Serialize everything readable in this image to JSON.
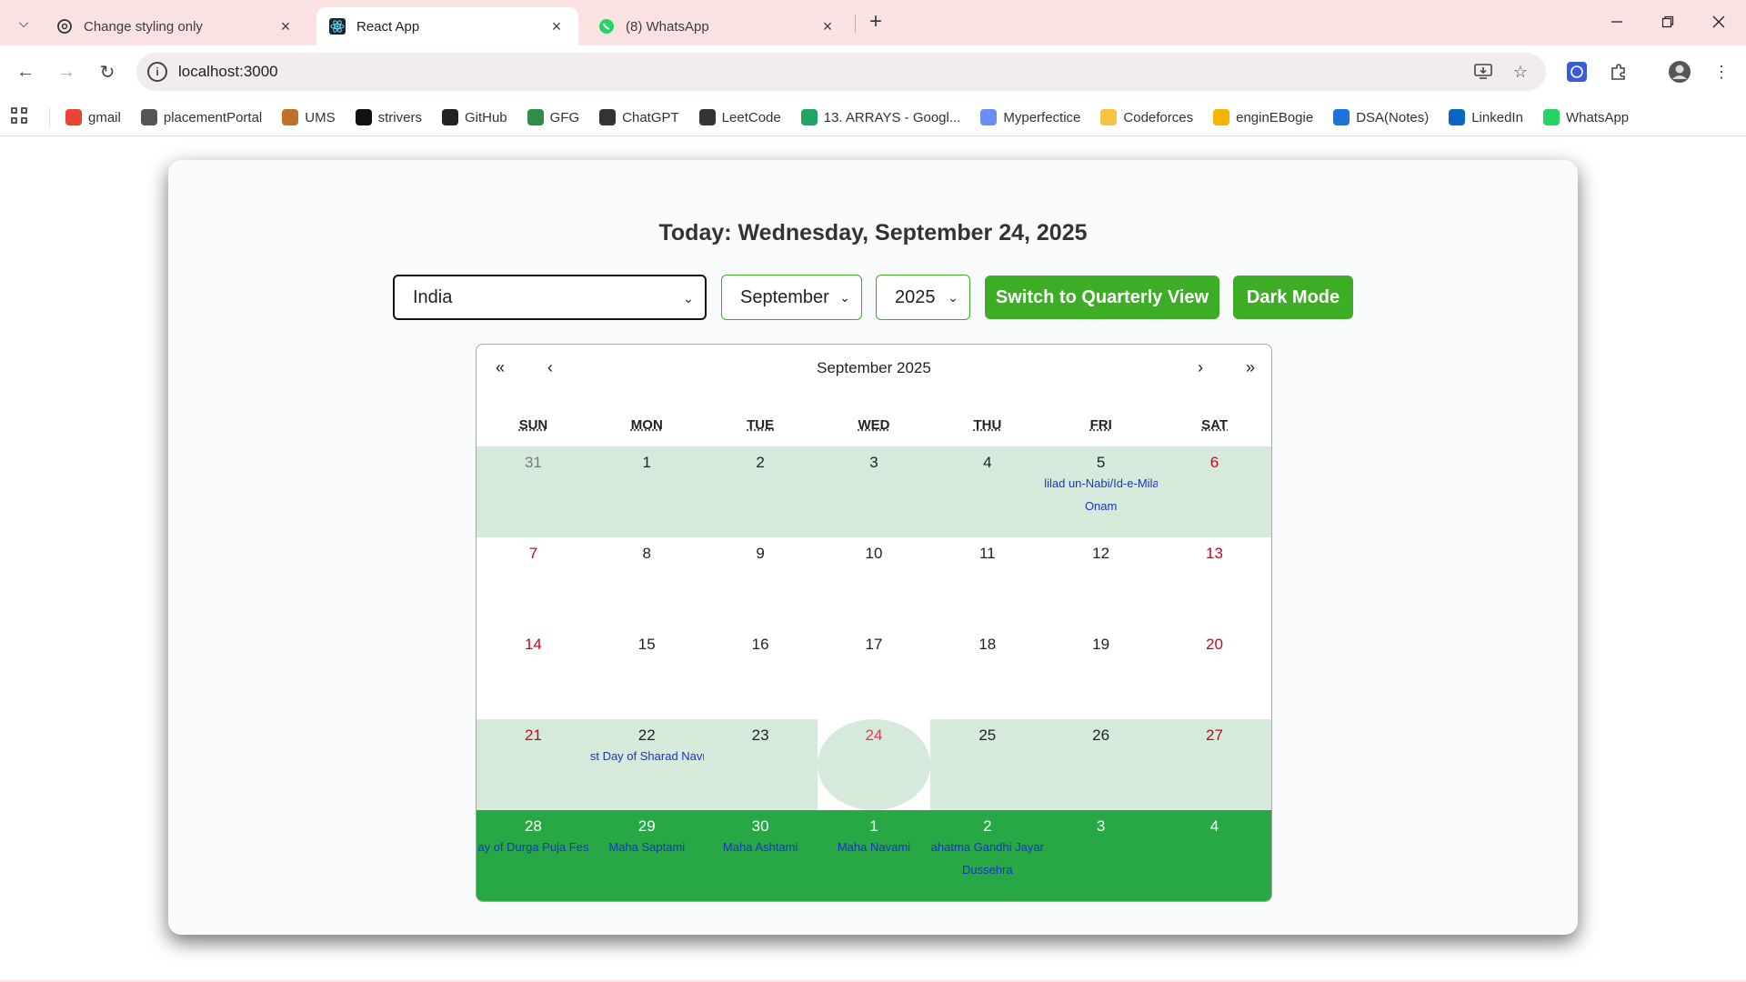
{
  "browser": {
    "tabs": [
      {
        "title": "Change styling only",
        "icon": "chatgpt-icon",
        "active": false
      },
      {
        "title": "React App",
        "icon": "react-icon",
        "active": true
      },
      {
        "title": "(8) WhatsApp",
        "icon": "whatsapp-icon",
        "active": false
      }
    ],
    "url": "localhost:3000",
    "bookmarks": [
      {
        "label": "gmail",
        "icon": "gmail-icon",
        "color": "#ea4335"
      },
      {
        "label": "placementPortal",
        "icon": "globe-icon",
        "color": "#555555"
      },
      {
        "label": "UMS",
        "icon": "ums-icon",
        "color": "#c0702a"
      },
      {
        "label": "strivers",
        "icon": "tuf-icon",
        "color": "#111111"
      },
      {
        "label": "GitHub",
        "icon": "github-icon",
        "color": "#222222"
      },
      {
        "label": "GFG",
        "icon": "gfg-icon",
        "color": "#2f8d46"
      },
      {
        "label": "ChatGPT",
        "icon": "chatgpt-icon",
        "color": "#333333"
      },
      {
        "label": "LeetCode",
        "icon": "leetcode-icon",
        "color": "#333333"
      },
      {
        "label": "13. ARRAYS - Googl...",
        "icon": "google-drive-icon",
        "color": "#1fa463"
      },
      {
        "label": "Myperfectice",
        "icon": "myperfectice-icon",
        "color": "#6b8df0"
      },
      {
        "label": "Codeforces",
        "icon": "codeforces-icon",
        "color": "#f6c343"
      },
      {
        "label": "enginEBogie",
        "icon": "enginebogie-icon",
        "color": "#f4b400"
      },
      {
        "label": "DSA(Notes)",
        "icon": "onedrive-icon",
        "color": "#1e73d8"
      },
      {
        "label": "LinkedIn",
        "icon": "linkedin-icon",
        "color": "#0a66c2"
      },
      {
        "label": "WhatsApp",
        "icon": "whatsapp-icon",
        "color": "#25d366"
      }
    ]
  },
  "app": {
    "today_text": "Today: Wednesday, September 24, 2025",
    "country": "India",
    "month": "September",
    "year": "2025",
    "quarterly_button": "Switch to Quarterly View",
    "dark_mode_button": "Dark Mode",
    "accent_color": "#3cad25"
  },
  "calendar": {
    "label": "September 2025",
    "nav": {
      "prev_year": "«",
      "prev_month": "‹",
      "next_month": "›",
      "next_year": "»"
    },
    "weekdays": [
      "SUN",
      "MON",
      "TUE",
      "WED",
      "THU",
      "FRI",
      "SAT"
    ],
    "weeks": [
      {
        "style": "hl",
        "days": [
          {
            "n": "31",
            "other": true
          },
          {
            "n": "1"
          },
          {
            "n": "2"
          },
          {
            "n": "3"
          },
          {
            "n": "4"
          },
          {
            "n": "5",
            "hol": [
              "lilad un-Nabi/Id-e-Mila",
              "Onam"
            ]
          },
          {
            "n": "6",
            "weekend": true
          }
        ]
      },
      {
        "style": "",
        "days": [
          {
            "n": "7",
            "weekend": true
          },
          {
            "n": "8"
          },
          {
            "n": "9"
          },
          {
            "n": "10"
          },
          {
            "n": "11"
          },
          {
            "n": "12"
          },
          {
            "n": "13",
            "weekend": true
          }
        ]
      },
      {
        "style": "",
        "days": [
          {
            "n": "14",
            "weekend": true
          },
          {
            "n": "15"
          },
          {
            "n": "16"
          },
          {
            "n": "17"
          },
          {
            "n": "18"
          },
          {
            "n": "19"
          },
          {
            "n": "20",
            "weekend": true
          }
        ]
      },
      {
        "style": "hl",
        "days": [
          {
            "n": "21",
            "weekend": true
          },
          {
            "n": "22",
            "hol": [
              "st Day of Sharad Navr"
            ]
          },
          {
            "n": "23"
          },
          {
            "n": "24",
            "today": true
          },
          {
            "n": "25"
          },
          {
            "n": "26"
          },
          {
            "n": "27",
            "weekend": true
          }
        ]
      },
      {
        "style": "next",
        "days": [
          {
            "n": "28",
            "hol": [
              "ay of Durga Puja Fes"
            ]
          },
          {
            "n": "29",
            "hol": [
              "Maha Saptami"
            ]
          },
          {
            "n": "30",
            "hol": [
              "Maha Ashtami"
            ]
          },
          {
            "n": "1",
            "hol": [
              "Maha Navami"
            ]
          },
          {
            "n": "2",
            "hol": [
              "ahatma Gandhi Jayar",
              "Dussehra"
            ]
          },
          {
            "n": "3"
          },
          {
            "n": "4"
          }
        ]
      }
    ]
  }
}
